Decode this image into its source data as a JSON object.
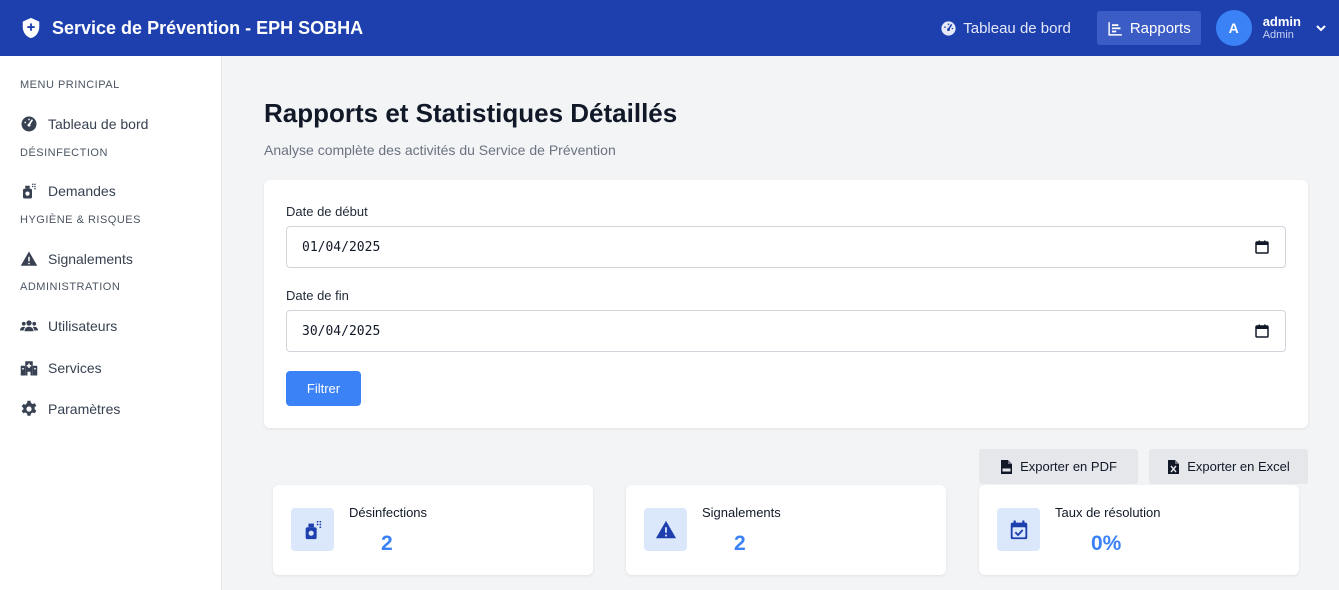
{
  "header": {
    "title": "Service de Prévention - EPH SOBHA",
    "nav": [
      {
        "label": "Tableau de bord",
        "icon": "gauge-icon"
      },
      {
        "label": "Rapports",
        "icon": "bar-chart-icon",
        "active": true
      }
    ],
    "user": {
      "initial": "A",
      "name": "admin",
      "role": "Admin"
    }
  },
  "sidebar": {
    "sections": [
      {
        "heading": "MENU PRINCIPAL",
        "items": [
          {
            "label": "Tableau de bord",
            "icon": "gauge-icon"
          }
        ]
      },
      {
        "heading": "DÉSINFECTION",
        "items": [
          {
            "label": "Demandes",
            "icon": "pump-soap-icon"
          }
        ]
      },
      {
        "heading": "HYGIÈNE & RISQUES",
        "items": [
          {
            "label": "Signalements",
            "icon": "warning-icon"
          }
        ]
      },
      {
        "heading": "ADMINISTRATION",
        "items": [
          {
            "label": "Utilisateurs",
            "icon": "users-icon"
          },
          {
            "label": "Services",
            "icon": "hospital-icon"
          },
          {
            "label": "Paramètres",
            "icon": "gear-icon"
          }
        ]
      }
    ]
  },
  "main": {
    "title": "Rapports et Statistiques Détaillés",
    "subtitle": "Analyse complète des activités du Service de Prévention",
    "filter": {
      "start_label": "Date de début",
      "start_value": "01/04/2025",
      "end_label": "Date de fin",
      "end_value": "30/04/2025",
      "button": "Filtrer"
    },
    "export": {
      "pdf": "Exporter en PDF",
      "excel": "Exporter en Excel"
    },
    "stats": [
      {
        "label": "Désinfections",
        "value": "2",
        "icon": "pump-soap-icon"
      },
      {
        "label": "Signalements",
        "value": "2",
        "icon": "warning-icon"
      },
      {
        "label": "Taux de résolution",
        "value": "0%",
        "icon": "calendar-check-icon"
      }
    ]
  },
  "colors": {
    "primary": "#1e40af",
    "accent": "#3b82f6",
    "background": "#f3f4f6"
  }
}
